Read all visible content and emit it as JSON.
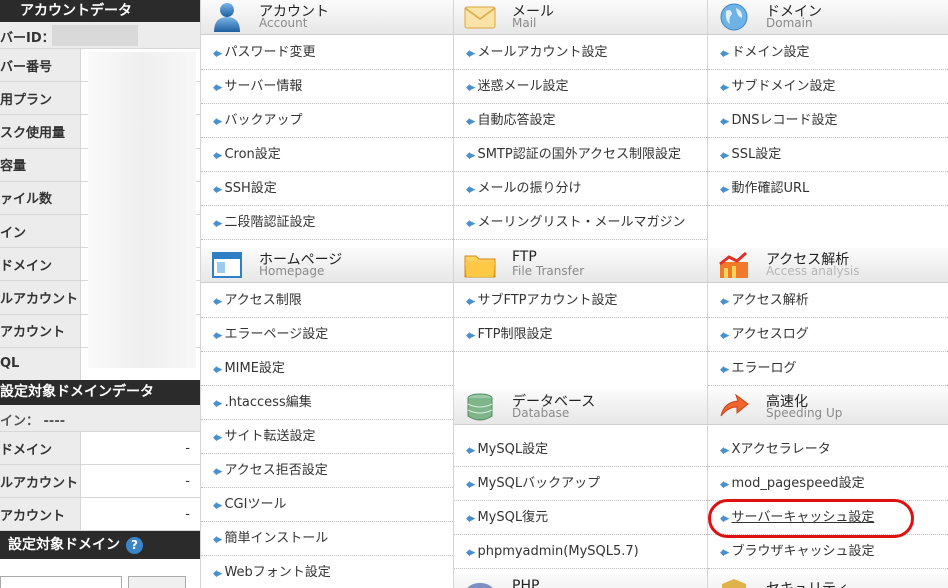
{
  "sidebar": {
    "account_header": "アカウントデータ",
    "server_id_label": "バーID：",
    "rows": [
      {
        "label": "バー番号",
        "value": ""
      },
      {
        "label": "用プラン",
        "value": ""
      },
      {
        "label": "スク使用量",
        "value": ""
      },
      {
        "label": "容量",
        "value": ""
      },
      {
        "label": "ァイル数",
        "value": ""
      },
      {
        "label": "イン",
        "value": ""
      },
      {
        "label": "ドメイン",
        "value": ""
      },
      {
        "label": "ルアカウント",
        "value": ""
      },
      {
        "label": "アカウント",
        "value": ""
      },
      {
        "label": "QL",
        "value": ""
      }
    ],
    "domain_header": "設定対象ドメインデータ",
    "domain_label": "イン： ----",
    "domain_rows": [
      {
        "label": "ドメイン",
        "value": "-"
      },
      {
        "label": "ルアカウント",
        "value": "-"
      },
      {
        "label": "アカウント",
        "value": "-"
      }
    ],
    "target_header": "設定対象ドメイン",
    "help_icon": "?"
  },
  "panels": {
    "account": {
      "title": "アカウント",
      "subtitle": "Account",
      "icon": "user-icon",
      "items": [
        "パスワード変更",
        "サーバー情報",
        "バックアップ",
        "Cron設定",
        "SSH設定",
        "二段階認証設定"
      ]
    },
    "mail": {
      "title": "メール",
      "subtitle": "Mail",
      "icon": "envelope-icon",
      "items": [
        "メールアカウント設定",
        "迷惑メール設定",
        "自動応答設定",
        "SMTP認証の国外アクセス制限設定",
        "メールの振り分け",
        "メーリングリスト・メールマガジン"
      ]
    },
    "domain": {
      "title": "ドメイン",
      "subtitle": "Domain",
      "icon": "globe-icon",
      "items": [
        "ドメイン設定",
        "サブドメイン設定",
        "DNSレコード設定",
        "SSL設定",
        "動作確認URL"
      ]
    },
    "homepage": {
      "title": "ホームページ",
      "subtitle": "Homepage",
      "icon": "browser-window-icon",
      "items": [
        "アクセス制限",
        "エラーページ設定",
        "MIME設定",
        ".htaccess編集",
        "サイト転送設定",
        "アクセス拒否設定",
        "CGIツール",
        "簡単インストール",
        "Webフォント設定"
      ]
    },
    "ftp": {
      "title": "FTP",
      "subtitle": "File Transfer",
      "icon": "folder-icon",
      "items": [
        "サブFTPアカウント設定",
        "FTP制限設定"
      ]
    },
    "analytics": {
      "title": "アクセス解析",
      "subtitle": "Access analysis",
      "icon": "chart-icon",
      "items": [
        "アクセス解析",
        "アクセスログ",
        "エラーログ"
      ]
    },
    "database": {
      "title": "データベース",
      "subtitle": "Database",
      "icon": "database-icon",
      "items": [
        "MySQL設定",
        "MySQLバックアップ",
        "MySQL復元",
        "phpmyadmin(MySQL5.7)"
      ]
    },
    "speed": {
      "title": "高速化",
      "subtitle": "Speeding Up",
      "icon": "speed-arrow-icon",
      "items": [
        "Xアクセラレータ",
        "mod_pagespeed設定",
        "サーバーキャッシュ設定",
        "ブラウザキャッシュ設定"
      ]
    },
    "php": {
      "title": "PHP",
      "icon": "php-icon"
    },
    "security": {
      "title": "セキュリティ",
      "icon": "shield-icon"
    }
  },
  "colors": {
    "sidebar_header": "#2b2b2b",
    "label_bg": "#ececec",
    "arrow": "#4a8fcf",
    "highlight": "#e01010"
  }
}
